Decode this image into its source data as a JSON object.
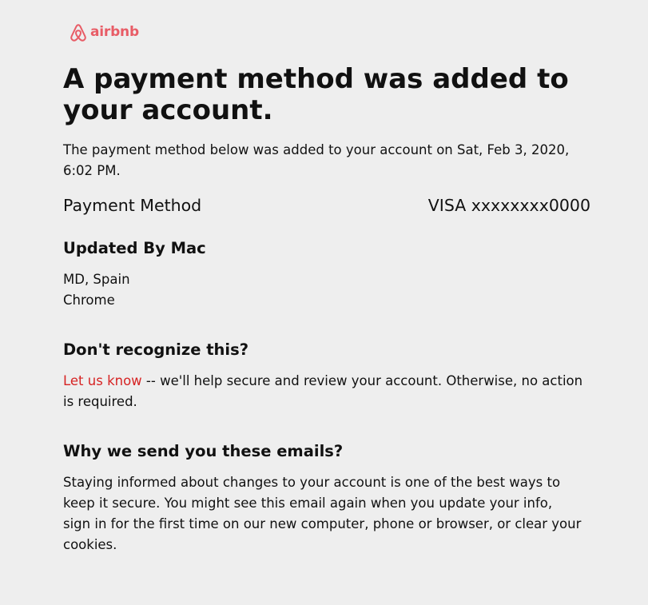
{
  "brand": {
    "logo_text": "airbnb",
    "color": "#e85c66",
    "icon": "airbnb-belo-icon"
  },
  "headline": "A payment method was added to your account.",
  "intro": "The payment method below was added to your account on Sat, Feb 3, 2020, 6:02 PM.",
  "payment": {
    "label": "Payment Method",
    "value": "VISA xxxxxxxx0000"
  },
  "updated_by": {
    "title": "Updated By Mac",
    "location": "MD, Spain",
    "browser": "Chrome"
  },
  "dont_recognize": {
    "title": "Don't recognize this?",
    "link_label": "Let us know",
    "rest": " -- we'll help secure and review your account. Otherwise, no action is required.",
    "link_color": "#d62323"
  },
  "why": {
    "title": "Why we send you these emails?",
    "body": "Staying informed about changes to your account is one of the best ways to keep it secure. You might see this email again when you update your info, sign in for the first time on our new computer, phone or browser, or clear your cookies."
  }
}
